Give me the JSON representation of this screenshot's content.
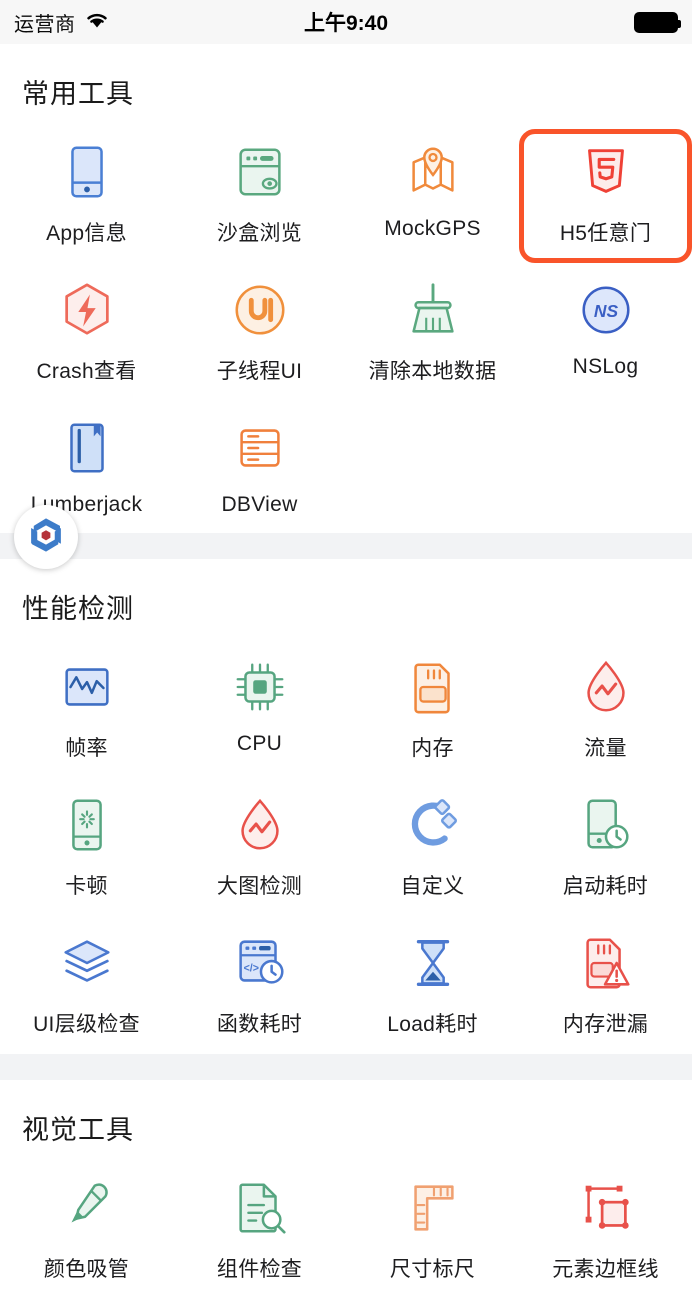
{
  "status_bar": {
    "carrier": "运营商",
    "wifi_icon": "wifi-icon",
    "time": "上午9:40",
    "battery_icon": "battery-full-icon"
  },
  "floating_button": {
    "icon": "hexagon-logo-icon"
  },
  "sections": [
    {
      "title": "常用工具",
      "items": [
        {
          "label": "App信息",
          "icon": "phone-info-icon",
          "color": "#4a7fd4",
          "selected": false
        },
        {
          "label": "沙盒浏览",
          "icon": "sandbox-browse-icon",
          "color": "#5aa87f",
          "selected": false
        },
        {
          "label": "MockGPS",
          "icon": "map-pin-icon",
          "color": "#f08a3c",
          "selected": false
        },
        {
          "label": "H5任意门",
          "icon": "html5-shield-icon",
          "color": "#ef4136",
          "selected": true
        },
        {
          "label": "Crash查看",
          "icon": "crash-bolt-icon",
          "color": "#ee6a5a",
          "selected": false
        },
        {
          "label": "子线程UI",
          "icon": "ui-circle-icon",
          "color": "#f0903c",
          "selected": false
        },
        {
          "label": "清除本地数据",
          "icon": "broom-icon",
          "color": "#5aa87f",
          "selected": false
        },
        {
          "label": "NSLog",
          "icon": "nslog-circle-icon",
          "color": "#3a5fc4",
          "selected": false
        },
        {
          "label": "Lumberjack",
          "icon": "book-icon",
          "color": "#3f6fc4",
          "selected": false
        },
        {
          "label": "DBView",
          "icon": "database-icon",
          "color": "#f0803c",
          "selected": false
        }
      ]
    },
    {
      "title": "性能检测",
      "items": [
        {
          "label": "帧率",
          "icon": "chart-fps-icon",
          "color": "#3f6fc4",
          "selected": false
        },
        {
          "label": "CPU",
          "icon": "cpu-chip-icon",
          "color": "#56a580",
          "selected": false
        },
        {
          "label": "内存",
          "icon": "memory-card-icon",
          "color": "#f0873c",
          "selected": false
        },
        {
          "label": "流量",
          "icon": "traffic-drop-icon",
          "color": "#e8514a",
          "selected": false
        },
        {
          "label": "卡顿",
          "icon": "lag-phone-icon",
          "color": "#56a580",
          "selected": false
        },
        {
          "label": "大图检测",
          "icon": "bigimage-drop-icon",
          "color": "#e8514a",
          "selected": false
        },
        {
          "label": "自定义",
          "icon": "magnet-custom-icon",
          "color": "#6f9ce0",
          "selected": false
        },
        {
          "label": "启动耗时",
          "icon": "launch-time-icon",
          "color": "#56a580",
          "selected": false
        },
        {
          "label": "UI层级检查",
          "icon": "layers-icon",
          "color": "#4a78cf",
          "selected": false
        },
        {
          "label": "函数耗时",
          "icon": "function-time-icon",
          "color": "#4a78cf",
          "selected": false
        },
        {
          "label": "Load耗时",
          "icon": "hourglass-icon",
          "color": "#4a78cf",
          "selected": false
        },
        {
          "label": "内存泄漏",
          "icon": "memory-leak-icon",
          "color": "#e8514a",
          "selected": false
        }
      ]
    },
    {
      "title": "视觉工具",
      "items": [
        {
          "label": "颜色吸管",
          "icon": "color-picker-icon",
          "color": "#56a580",
          "selected": false
        },
        {
          "label": "组件检查",
          "icon": "doc-inspect-icon",
          "color": "#56a580",
          "selected": false
        },
        {
          "label": "尺寸标尺",
          "icon": "ruler-icon",
          "color": "#f0a070",
          "selected": false
        },
        {
          "label": "元素边框线",
          "icon": "element-border-icon",
          "color": "#e8514a",
          "selected": false
        }
      ]
    }
  ]
}
